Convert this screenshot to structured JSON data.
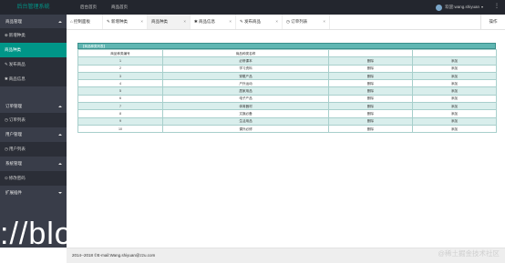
{
  "header": {
    "logo": "后台管理系统",
    "nav": [
      "后台首页",
      "商品首页"
    ],
    "username": "欢迎:wang.shiyuan"
  },
  "sidebar": {
    "groups": [
      {
        "label": "商品管理",
        "items": [
          "新增种类",
          "商品种类",
          "发布商品",
          "商品信息"
        ]
      },
      {
        "label": "订单管理",
        "items": [
          "订单列表"
        ]
      },
      {
        "label": "用户管理",
        "items": [
          "用户列表"
        ]
      },
      {
        "label": "系统管理",
        "items": [
          "修改密码"
        ]
      },
      {
        "label": "扩展插件",
        "items": []
      }
    ],
    "active_item": "商品种类"
  },
  "tabs": [
    {
      "label": "控制面板",
      "closable": false
    },
    {
      "label": "新增种类",
      "closable": true
    },
    {
      "label": "商品种类",
      "closable": true,
      "active": true
    },
    {
      "label": "商品信息",
      "closable": true
    },
    {
      "label": "发布商品",
      "closable": true
    },
    {
      "label": "订单列表",
      "closable": true
    }
  ],
  "ops_label": "操作",
  "table": {
    "caption": "【商品种类列表】",
    "headers": [
      "商品种类编号",
      "商品种类名称",
      "",
      ""
    ],
    "rows": [
      {
        "id": "1",
        "name": "必修课本",
        "delete": "删除",
        "add": "添加"
      },
      {
        "id": "2",
        "name": "学习资料",
        "delete": "删除",
        "add": "添加"
      },
      {
        "id": "3",
        "name": "穿戴产品",
        "delete": "删除",
        "add": "添加"
      },
      {
        "id": "4",
        "name": "户外运动",
        "delete": "删除",
        "add": "添加"
      },
      {
        "id": "5",
        "name": "居家用品",
        "delete": "删除",
        "add": "添加"
      },
      {
        "id": "6",
        "name": "电子产品",
        "delete": "删除",
        "add": "添加"
      },
      {
        "id": "7",
        "name": "体育器材",
        "delete": "删除",
        "add": "添加"
      },
      {
        "id": "8",
        "name": "文娱必备",
        "delete": "删除",
        "add": "添加"
      },
      {
        "id": "9",
        "name": "生活用品",
        "delete": "删除",
        "add": "添加"
      },
      {
        "id": "10",
        "name": "课外必修",
        "delete": "删除",
        "add": "添加"
      }
    ]
  },
  "footer": "2014--2018 ©E-mail:Wang.shiyuan@zzu.com",
  "overlay_text": "://blo",
  "watermark": "@稀土掘金技术社区",
  "colors": {
    "header_bg": "#23262e",
    "sidebar_bg": "#393d49",
    "accent": "#009688",
    "table_header": "#5fb6b2",
    "row_stripe": "#d9eeec"
  }
}
